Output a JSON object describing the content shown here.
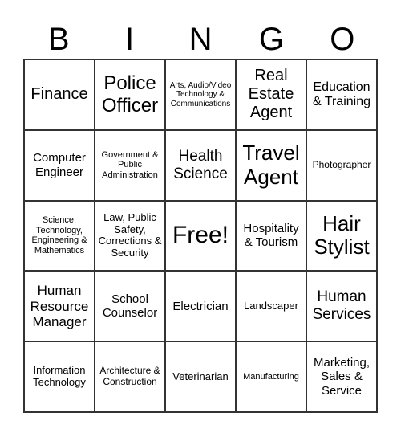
{
  "header": [
    "B",
    "I",
    "N",
    "G",
    "O"
  ],
  "cells": [
    "Finance",
    "Police Officer",
    "Arts, Audio/Video Technology & Communications",
    "Real Estate Agent",
    "Education & Training",
    "Computer Engineer",
    "Government & Public Administration",
    "Health Science",
    "Travel Agent",
    "Photographer",
    "Science, Technology, Engineering & Mathematics",
    "Law, Public Safety, Corrections & Security",
    "Free!",
    "Hospitality & Tourism",
    "Hair Stylist",
    "Human Resource Manager",
    "School Counselor",
    "Electrician",
    "Landscaper",
    "Human Services",
    "Information Technology",
    "Architecture & Construction",
    "Veterinarian",
    "Manufacturing",
    "Marketing, Sales & Service"
  ]
}
